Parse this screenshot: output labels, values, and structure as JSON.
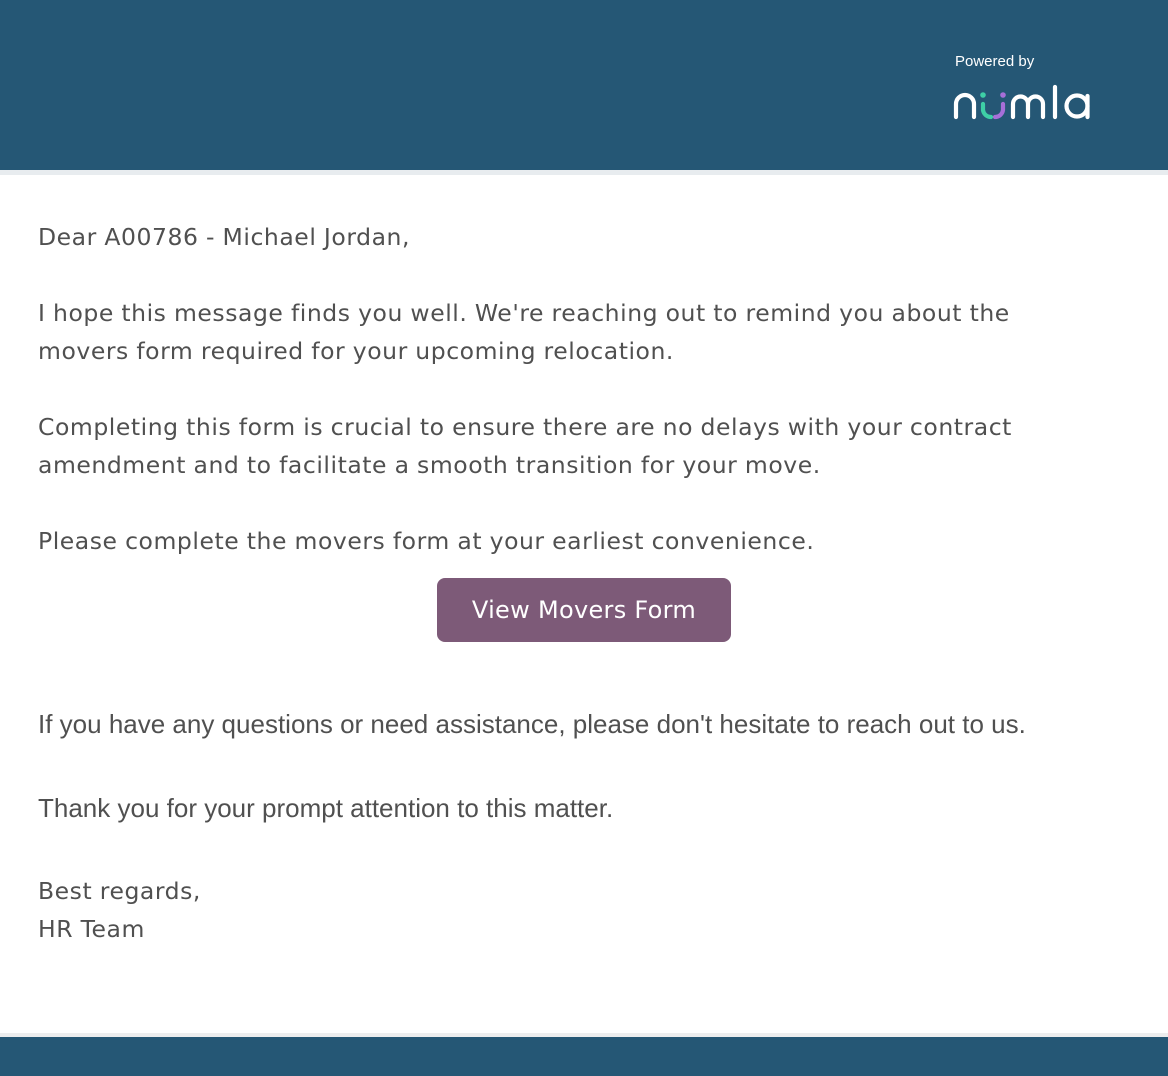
{
  "header": {
    "powered_by": "Powered by",
    "logo": {
      "name": "numla",
      "text_color": "#ffffff",
      "accent_left": "#3ecfa6",
      "accent_right": "#a66fd8"
    },
    "background": "#255775"
  },
  "email": {
    "greeting": "Dear A00786 - Michael Jordan,",
    "paragraph1": {
      "line1": "I hope this message finds you well. We're reaching out to remind you about the",
      "line2": "movers form required for your upcoming relocation."
    },
    "paragraph2": {
      "line1": "Completing this form is crucial to ensure there are no delays with your contract",
      "line2": "amendment and to facilitate a smooth transition for your move."
    },
    "paragraph3": "Please complete the movers form at your earliest convenience.",
    "cta_button": {
      "label": "View Movers Form",
      "color": "#7d5a78"
    },
    "paragraph4": "If you have any questions or need assistance, please don't hesitate to reach out to us.",
    "paragraph5": "Thank you for your prompt attention to this matter.",
    "signoff": "Best regards,",
    "signature": "HR Team"
  },
  "footer": {
    "background": "#255775"
  }
}
